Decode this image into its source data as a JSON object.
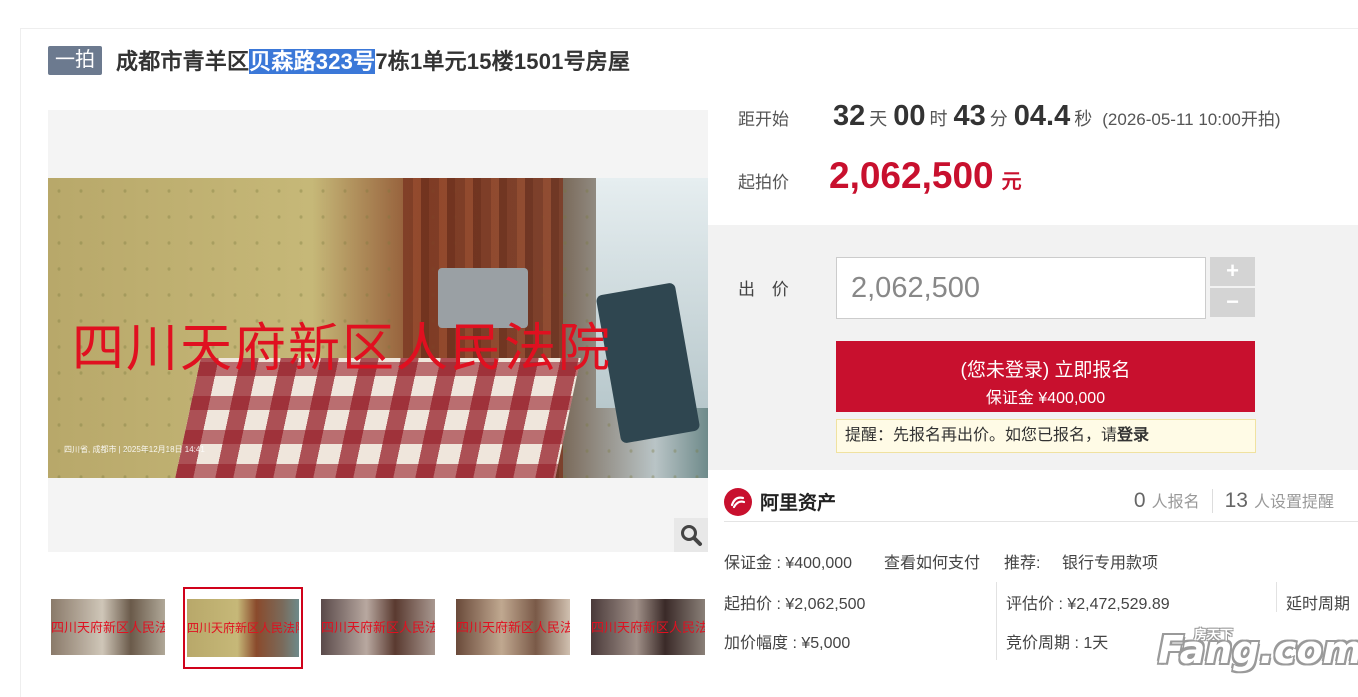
{
  "header": {
    "badge": "一拍",
    "title_prefix": "成都市青羊区",
    "title_highlight": "贝森路323号",
    "title_suffix": "7栋1单元15楼1501号房屋"
  },
  "gallery": {
    "main_watermark": "四川天府新区人民法院",
    "main_photo_caption": "四川省, 成都市 | 2025年12月18日 14:41",
    "thumbnail_watermark": "四川天府新区人民法院",
    "selected_thumbnail_index": 2,
    "thumbnail_count": 5
  },
  "countdown": {
    "label": "距开始",
    "days": "32",
    "days_unit": "天",
    "hours": "00",
    "hours_unit": "时",
    "minutes": "43",
    "minutes_unit": "分",
    "seconds": "04.4",
    "seconds_unit": "秒",
    "start_text": "(2026-05-11 10:00开拍)"
  },
  "starting_price": {
    "label": "起拍价",
    "value": "2,062,500",
    "unit": "元"
  },
  "bid": {
    "label": "出 价",
    "input_value": "2,062,500",
    "plus": "+",
    "minus": "−",
    "signup_line1": "(您未登录) 立即报名",
    "signup_line2": "保证金 ¥400,000",
    "tip_text": "提醒：先报名再出价。如您已报名，请",
    "tip_login": "登录"
  },
  "platform": {
    "name": "阿里资产",
    "signups_num": "0",
    "signups_label": "人报名",
    "reminders_num": "13",
    "reminders_label": "人设置提醒"
  },
  "details": {
    "deposit": "保证金 : ¥400,000",
    "deposit_link": "查看如何支付",
    "recommend_label": "推荐:",
    "recommend_link": "银行专用款项",
    "start_price": "起拍价 : ¥2,062,500",
    "appraisal": "评估价 : ¥2,472,529.89",
    "delay": "延时周期",
    "increment": "加价幅度 : ¥5,000",
    "bid_cycle": "竞价周期 : 1天"
  },
  "watermark_logo": {
    "small": "房天下",
    "big": "Fang.com"
  },
  "colors": {
    "accent_red": "#c8102e",
    "badge_gray": "#6c7a8f",
    "link_blue": "#3b78c8",
    "highlight_blue": "#3b78d8"
  }
}
